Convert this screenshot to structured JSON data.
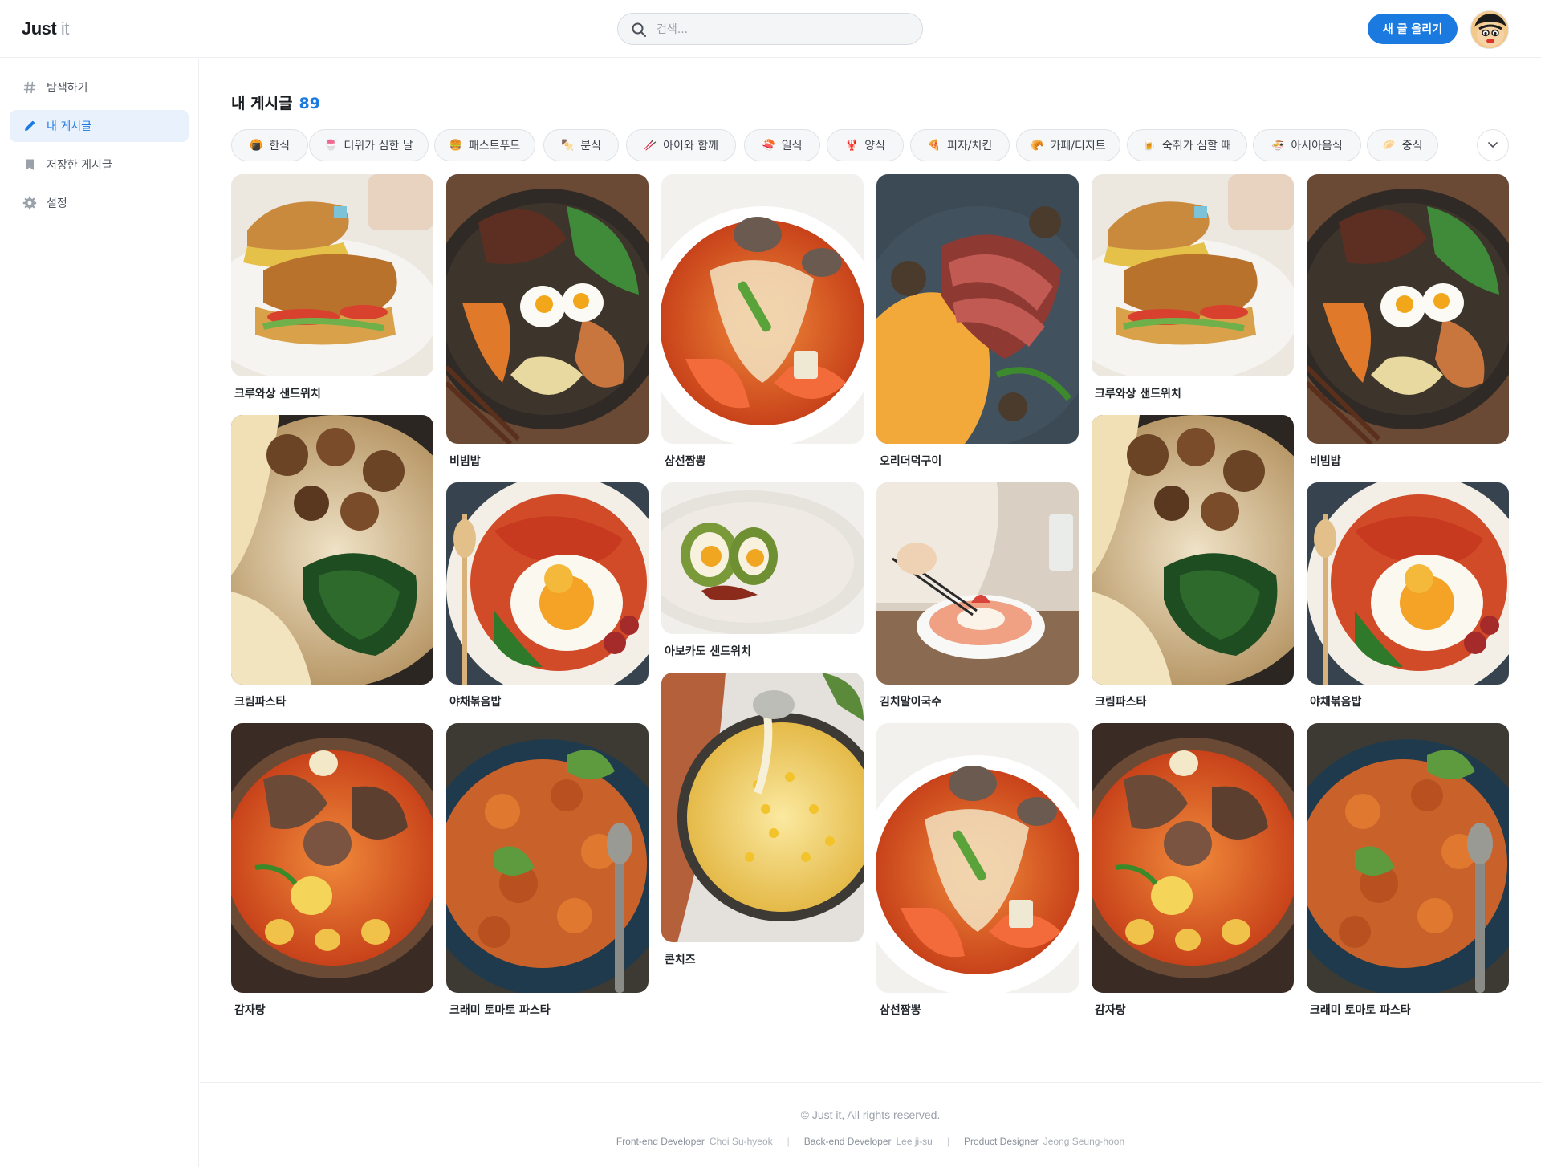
{
  "header": {
    "logo_main": "Just",
    "logo_sub": "it",
    "search_placeholder": "검색...",
    "new_post_label": "새 글 올리기"
  },
  "sidebar": {
    "items": [
      {
        "label": "탐색하기",
        "icon": "hash-icon"
      },
      {
        "label": "내 게시글",
        "icon": "pencil-icon",
        "active": true
      },
      {
        "label": "저장한 게시글",
        "icon": "bookmark-icon"
      },
      {
        "label": "설정",
        "icon": "gear-icon"
      }
    ]
  },
  "main": {
    "title": "내 게시글",
    "count": "89",
    "categories": [
      {
        "emoji": "🍘",
        "label": "한식"
      },
      {
        "emoji": "🍧",
        "label": "더위가 심한 날"
      },
      {
        "emoji": "🍔",
        "label": "패스트푸드"
      },
      {
        "emoji": "🍢",
        "label": "분식"
      },
      {
        "emoji": "🥢",
        "label": "아이와 함께"
      },
      {
        "emoji": "🍣",
        "label": "일식"
      },
      {
        "emoji": "🦞",
        "label": "양식"
      },
      {
        "emoji": "🍕",
        "label": "피자/치킨"
      },
      {
        "emoji": "🥐",
        "label": "카페/디저트"
      },
      {
        "emoji": "🍺",
        "label": "숙취가 심할 때"
      },
      {
        "emoji": "🍜",
        "label": "아시아음식"
      },
      {
        "emoji": "🥟",
        "label": "중식"
      }
    ],
    "posts": [
      {
        "name": "크루와상 샌드위치",
        "theme": "sandwich"
      },
      {
        "name": "비빔밥",
        "theme": "bibimbap"
      },
      {
        "name": "삼선짬뽕",
        "theme": "jjamppong"
      },
      {
        "name": "오리더덕구이",
        "theme": "duck"
      },
      {
        "name": "크루와상 샌드위치",
        "theme": "sandwich"
      },
      {
        "name": "비빔밥",
        "theme": "bibimbap"
      },
      {
        "name": "크림파스타",
        "theme": "creampasta"
      },
      {
        "name": "야채볶음밥",
        "theme": "friedrice"
      },
      {
        "name": "아보카도 샌드위치",
        "theme": "avocado"
      },
      {
        "name": "김치말이국수",
        "theme": "noodle"
      },
      {
        "name": "크림파스타",
        "theme": "creampasta"
      },
      {
        "name": "야채볶음밥",
        "theme": "friedrice"
      },
      {
        "name": "감자탕",
        "theme": "gamjatang"
      },
      {
        "name": "크래미 토마토 파스타",
        "theme": "tomatopasta"
      },
      {
        "name": "콘치즈",
        "theme": "corncheese"
      },
      {
        "name": "삼선짬뽕",
        "theme": "jjamppong"
      },
      {
        "name": "감자탕",
        "theme": "gamjatang"
      },
      {
        "name": "크래미 토마토 파스타",
        "theme": "tomatopasta"
      }
    ]
  },
  "footer": {
    "copyright": "© Just it, All rights reserved.",
    "credits": [
      {
        "role": "Front-end Developer",
        "person": "Choi Su-hyeok"
      },
      {
        "role": "Back-end Developer",
        "person": "Lee ji-su"
      },
      {
        "role": "Product Designer",
        "person": "Jeong Seung-hoon"
      }
    ]
  },
  "colors": {
    "accent": "#1b7ae0",
    "active_bg": "#e8f1fc"
  }
}
